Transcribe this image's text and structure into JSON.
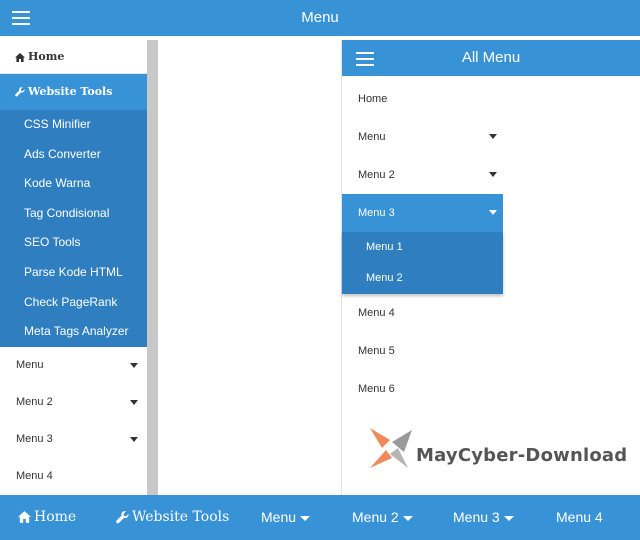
{
  "topbar": {
    "title": "Menu",
    "menu_icon": "hamburger-icon"
  },
  "sidebar": {
    "home": {
      "label": "Home",
      "icon": "home-icon"
    },
    "tools": {
      "label": "Website Tools",
      "icon": "wrench-icon"
    },
    "tools_items": [
      "CSS Minifier",
      "Ads Converter",
      "Kode Warna",
      "Tag Condisional",
      "SEO Tools",
      "Parse Kode HTML",
      "Check PageRank",
      "Meta Tags Analyzer"
    ],
    "menu_items": [
      {
        "label": "Menu",
        "caret": true
      },
      {
        "label": "Menu 2",
        "caret": true
      },
      {
        "label": "Menu 3",
        "caret": true
      },
      {
        "label": "Menu 4",
        "caret": false
      }
    ]
  },
  "panel": {
    "title": "All Menu",
    "items": [
      {
        "label": "Home"
      },
      {
        "label": "Menu"
      },
      {
        "label": "Menu 2"
      },
      {
        "label": "Menu 3"
      },
      {
        "label": "Menu 4"
      },
      {
        "label": "Menu 5"
      },
      {
        "label": "Menu 6"
      }
    ],
    "submenu": [
      "Menu 1",
      "Menu 2"
    ]
  },
  "watermark": {
    "text": "MayCyber-Download"
  },
  "bottom_nav": {
    "items": [
      {
        "label": "Home"
      },
      {
        "label": "Website Tools"
      },
      {
        "label": "Menu"
      },
      {
        "label": "Menu 2"
      },
      {
        "label": "Menu 3"
      },
      {
        "label": "Menu 4"
      }
    ]
  },
  "colors": {
    "primary": "#3792d6",
    "submenu": "#2f7fc0",
    "text": "#333333",
    "scrollbar": "#c8c8c8"
  }
}
